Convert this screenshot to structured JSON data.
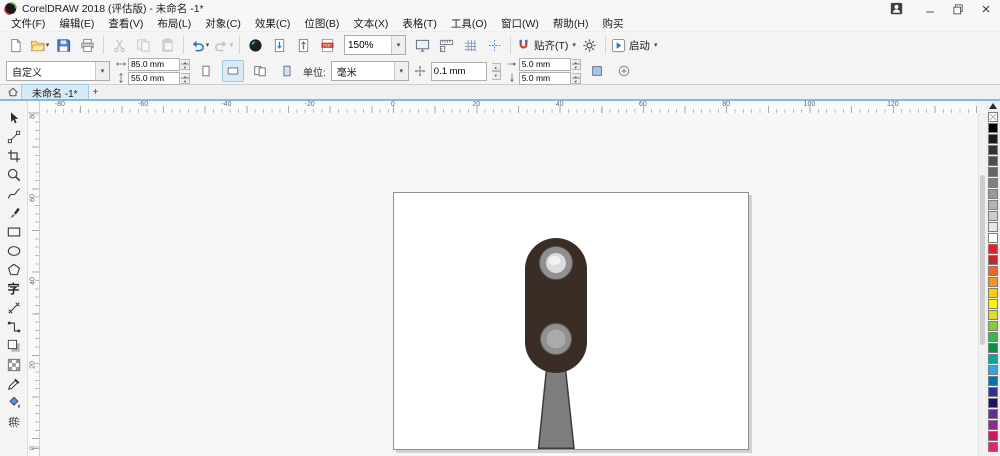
{
  "window": {
    "title": "CorelDRAW 2018 (评估版) - 未命名 -1*"
  },
  "menu_bar": {
    "items": [
      {
        "name": "menu-file",
        "label": "文件(F)"
      },
      {
        "name": "menu-edit",
        "label": "编辑(E)"
      },
      {
        "name": "menu-view",
        "label": "查看(V)"
      },
      {
        "name": "menu-layout",
        "label": "布局(L)"
      },
      {
        "name": "menu-object",
        "label": "对象(C)"
      },
      {
        "name": "menu-effects",
        "label": "效果(C)"
      },
      {
        "name": "menu-bitmaps",
        "label": "位图(B)"
      },
      {
        "name": "menu-text",
        "label": "文本(X)"
      },
      {
        "name": "menu-table",
        "label": "表格(T)"
      },
      {
        "name": "menu-tools",
        "label": "工具(O)"
      },
      {
        "name": "menu-window",
        "label": "窗口(W)"
      },
      {
        "name": "menu-help",
        "label": "帮助(H)"
      },
      {
        "name": "menu-buy",
        "label": "购买"
      }
    ]
  },
  "standard_toolbar": {
    "zoom_value": "150%",
    "items": [
      {
        "type": "button",
        "name": "new-document",
        "icon": "new-document"
      },
      {
        "type": "button",
        "name": "open-document",
        "icon": "open-folder",
        "caret": true
      },
      {
        "type": "button",
        "name": "save",
        "icon": "save"
      },
      {
        "type": "button",
        "name": "print",
        "icon": "print"
      },
      {
        "type": "sep"
      },
      {
        "type": "button",
        "name": "cut",
        "icon": "cut",
        "disabled": true
      },
      {
        "type": "button",
        "name": "copy",
        "icon": "copy",
        "disabled": true
      },
      {
        "type": "button",
        "name": "paste",
        "icon": "paste",
        "disabled": true
      },
      {
        "type": "sep"
      },
      {
        "type": "button",
        "name": "undo",
        "icon": "undo",
        "caret": true
      },
      {
        "type": "button",
        "name": "redo",
        "icon": "redo",
        "caret": true,
        "disabled": true
      },
      {
        "type": "sep"
      },
      {
        "type": "button",
        "name": "search-content",
        "icon": "search-content"
      },
      {
        "type": "button",
        "name": "import",
        "icon": "import"
      },
      {
        "type": "button",
        "name": "export",
        "icon": "export"
      },
      {
        "type": "button",
        "name": "publish-to-pdf",
        "icon": "publish-pdf"
      },
      {
        "type": "zoom"
      },
      {
        "type": "button",
        "name": "full-screen-preview",
        "icon": "full-screen-preview"
      },
      {
        "type": "button",
        "name": "show-rulers",
        "icon": "show-rulers"
      },
      {
        "type": "button",
        "name": "show-grid",
        "icon": "show-grid"
      },
      {
        "type": "button",
        "name": "show-guidelines",
        "icon": "show-guidelines"
      },
      {
        "type": "sep"
      },
      {
        "type": "button",
        "name": "snap-to",
        "icon": "snap-to",
        "label": "贴齐(T)",
        "caret": true
      },
      {
        "type": "button",
        "name": "options",
        "icon": "options-gear"
      },
      {
        "type": "sep"
      },
      {
        "type": "button",
        "name": "launch",
        "icon": "launch",
        "label": "启动",
        "caret": true
      }
    ]
  },
  "property_bar": {
    "page_preset": "自定义",
    "width_value": "85.0 mm",
    "height_value": "55.0 mm",
    "units_label": "单位:",
    "units_value": "毫米",
    "nudge_value": "0.1 mm",
    "dup_x_value": "5.0 mm",
    "dup_y_value": "5.0 mm"
  },
  "document_tabs": {
    "active": "未命名 -1*",
    "add_label": "+"
  },
  "rulers": {
    "horizontal_mm": [
      -80,
      -60,
      -40,
      -20,
      0,
      20,
      40,
      60,
      80,
      100,
      120
    ],
    "vertical_mm": [
      80,
      60,
      40,
      20,
      0
    ]
  },
  "toolbox": {
    "tools": [
      {
        "name": "pick-tool"
      },
      {
        "name": "shape-tool"
      },
      {
        "name": "crop-tool"
      },
      {
        "name": "zoom-tool"
      },
      {
        "name": "freehand-tool"
      },
      {
        "name": "artistic-media-tool"
      },
      {
        "name": "rectangle-tool"
      },
      {
        "name": "ellipse-tool"
      },
      {
        "name": "polygon-tool"
      },
      {
        "name": "text-tool",
        "glyph": "字"
      },
      {
        "name": "parallel-dimension-tool"
      },
      {
        "name": "connector-tool"
      },
      {
        "name": "drop-shadow-tool"
      },
      {
        "name": "transparency-tool"
      },
      {
        "name": "eyedropper-tool"
      },
      {
        "name": "interactive-fill-tool"
      },
      {
        "name": "mesh-fill-tool"
      }
    ]
  },
  "palette": {
    "colors": [
      "none",
      "#000000",
      "#1a1a1a",
      "#333333",
      "#4d4d4d",
      "#666666",
      "#808080",
      "#999999",
      "#b3b3b3",
      "#cccccc",
      "#e6e6e6",
      "#ffffff",
      "#ed1c24",
      "#c1272d",
      "#f26522",
      "#f7941d",
      "#ffcb05",
      "#fff200",
      "#d9e021",
      "#8dc63f",
      "#39b54a",
      "#009245",
      "#00a99d",
      "#29abe2",
      "#0072bc",
      "#2e3192",
      "#1b1464",
      "#662d91",
      "#92278f",
      "#d4145a",
      "#ed1e79"
    ]
  },
  "canvas": {
    "drawing": {
      "body_color": "#3a2d25",
      "top_ring_color": "#909090",
      "top_center_color": "#dcdcdc",
      "top_highlight_color": "#f2f2f2",
      "bottom_ring_color": "#909090",
      "bottom_center_color": "#ababab",
      "pole_color": "#7d7d7d"
    }
  }
}
